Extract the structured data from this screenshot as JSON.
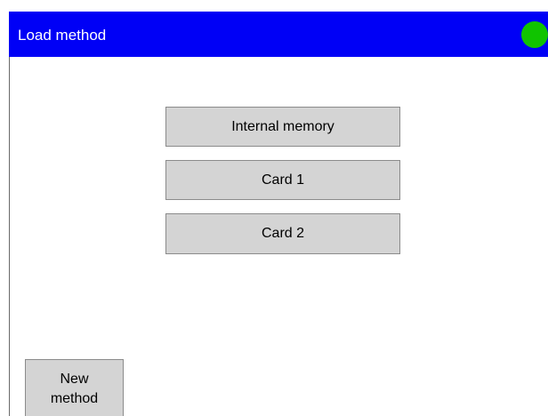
{
  "window": {
    "title": "Load method"
  },
  "status": {
    "color": "#10c400",
    "icon": "status-indicator-green"
  },
  "colors": {
    "title_bar": "#0000f6",
    "button_face": "#d4d4d4",
    "button_border": "#8b8b8b"
  },
  "sources": {
    "internal_memory_label": "Internal memory",
    "card1_label": "Card 1",
    "card2_label": "Card 2"
  },
  "actions": {
    "new_method_label": "New\nmethod"
  }
}
